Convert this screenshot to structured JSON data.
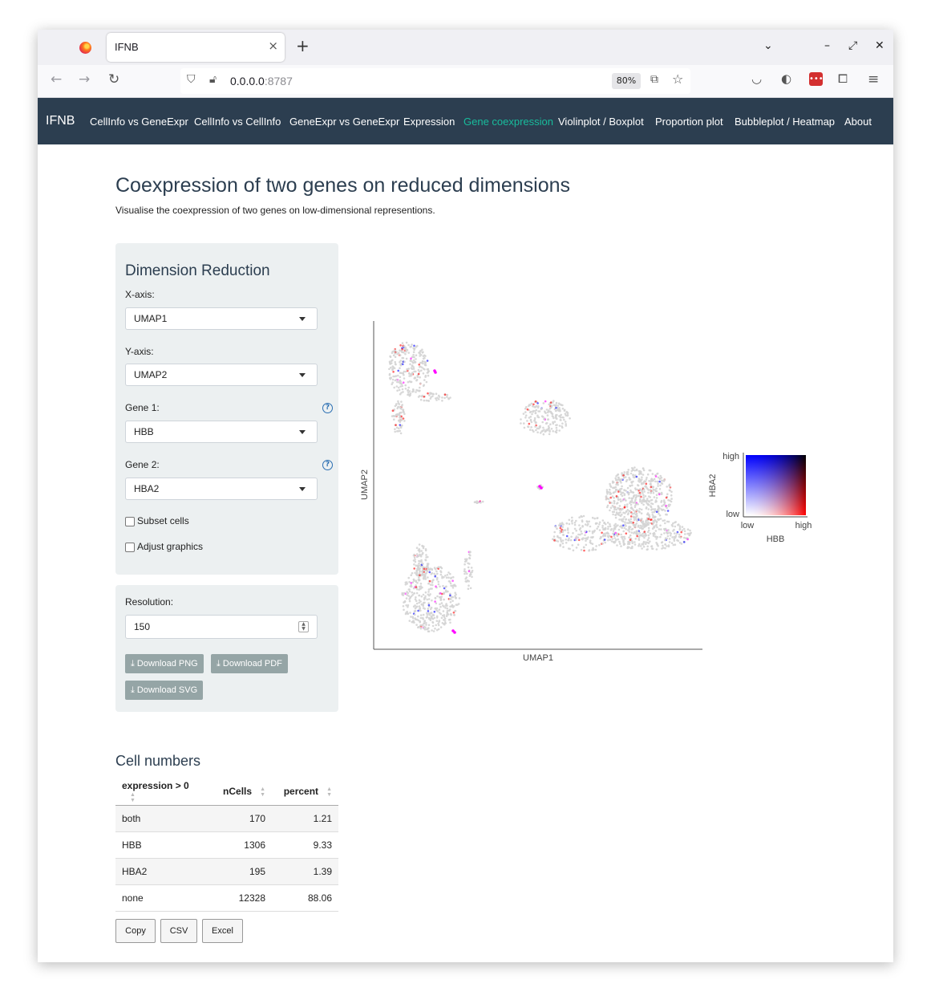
{
  "browser": {
    "tab_title": "IFNB",
    "tab_close": "×",
    "new_tab": "+",
    "url_host": "0.0.0.0",
    "url_port": ":8787",
    "zoom": "80%"
  },
  "app": {
    "brand": "IFNB",
    "nav": [
      {
        "label": "CellInfo vs GeneExpr",
        "active": false
      },
      {
        "label": "CellInfo vs CellInfo",
        "active": false
      },
      {
        "label": "GeneExpr vs GeneExpr",
        "active": false
      },
      {
        "label": "Expression",
        "active": false
      },
      {
        "label": "Gene coexpression",
        "active": true
      },
      {
        "label": "Violinplot / Boxplot",
        "active": false
      },
      {
        "label": "Proportion plot",
        "active": false
      },
      {
        "label": "Bubbleplot / Heatmap",
        "active": false
      },
      {
        "label": "About",
        "active": false
      }
    ]
  },
  "page": {
    "title": "Coexpression of two genes on reduced dimensions",
    "subtitle": "Visualise the coexpression of two genes on low-dimensional representions."
  },
  "panel": {
    "title": "Dimension Reduction",
    "x_axis_label": "X-axis:",
    "x_axis_value": "UMAP1",
    "y_axis_label": "Y-axis:",
    "y_axis_value": "UMAP2",
    "gene1_label": "Gene 1:",
    "gene1_value": "HBB",
    "gene2_label": "Gene 2:",
    "gene2_value": "HBA2",
    "help_glyph": "?",
    "subset_label": "Subset cells",
    "adjust_label": "Adjust graphics"
  },
  "download": {
    "resolution_label": "Resolution:",
    "resolution_value": "150",
    "png": "Download PNG",
    "pdf": "Download PDF",
    "svg": "Download SVG"
  },
  "cell_numbers": {
    "title": "Cell numbers",
    "columns": [
      "expression > 0",
      "nCells",
      "percent"
    ],
    "rows": [
      [
        "both",
        "170",
        "1.21"
      ],
      [
        "HBB",
        "1306",
        "9.33"
      ],
      [
        "HBA2",
        "195",
        "1.39"
      ],
      [
        "none",
        "12328",
        "88.06"
      ]
    ],
    "buttons": [
      "Copy",
      "CSV",
      "Excel"
    ]
  },
  "chart_data": {
    "type": "scatter",
    "xlabel": "UMAP1",
    "ylabel": "UMAP2",
    "colors": {
      "none": "#d4d4d4",
      "HBB": "#ff0000",
      "HBA2": "#0000ff",
      "both": "#ff00ff"
    },
    "legend": {
      "placement": "right",
      "x_title": "HBB",
      "y_title": "HBA2",
      "x_low": "low",
      "x_high": "high",
      "y_low": "low",
      "y_high": "high"
    }
  }
}
